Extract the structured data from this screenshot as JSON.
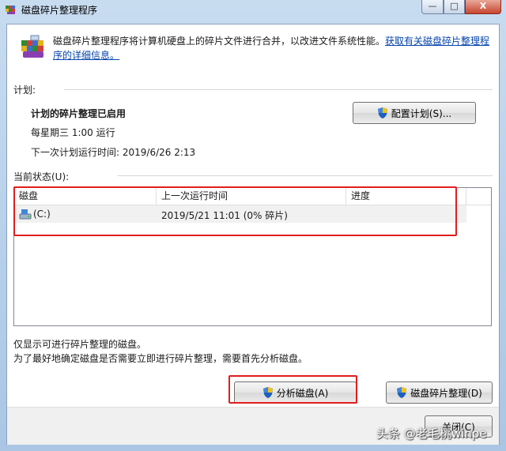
{
  "window": {
    "title": "磁盘碎片整理程序",
    "min_label": "—",
    "max_label": "□",
    "close_label": "X"
  },
  "description": {
    "text": "磁盘碎片整理程序将计算机硬盘上的碎片文件进行合并，以改进文件系统性能。",
    "link": "获取有关磁盘碎片整理程序的详细信息。"
  },
  "schedule": {
    "section_label": "计划:",
    "status": "计划的碎片整理已启用",
    "frequency": "每星期三  1:00 运行",
    "next_run": "下一次计划运行时间: 2019/6/26 2:13",
    "configure_button": "配置计划(S)..."
  },
  "current_status": {
    "section_label": "当前状态(U):",
    "columns": [
      "磁盘",
      "上一次运行时间",
      "进度"
    ],
    "rows": [
      {
        "disk": "(C:)",
        "last_run": "2019/5/21 11:01 (0% 碎片)",
        "progress": ""
      }
    ]
  },
  "notes": {
    "line1": "仅显示可进行碎片整理的磁盘。",
    "line2": "为了最好地确定磁盘是否需要立即进行碎片整理，需要首先分析磁盘。"
  },
  "actions": {
    "analyze_button": "分析磁盘(A)",
    "defrag_button": "磁盘碎片整理(D)",
    "close_button": "关闭(C)"
  },
  "watermark": "头条 @老毛桃winpe",
  "colors": {
    "highlight_box": "#e01e1e",
    "link": "#0645ad",
    "frame": "#bcd3ea"
  }
}
